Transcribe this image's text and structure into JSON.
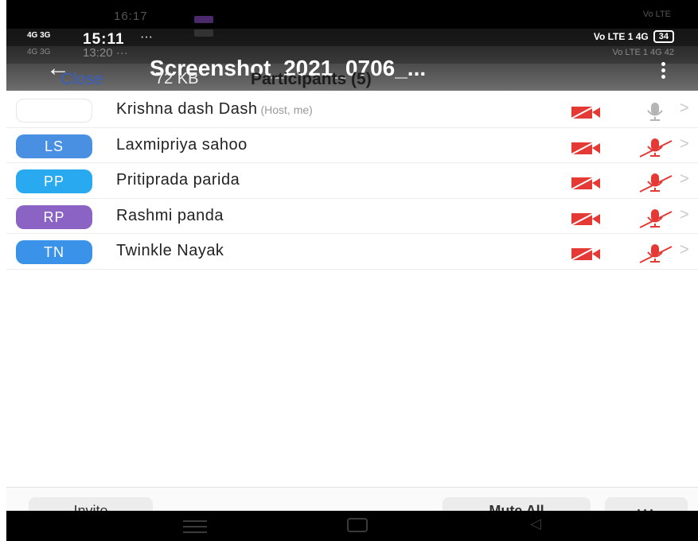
{
  "status_faint": {
    "time": "16:17",
    "right": "Vo LTE"
  },
  "status_main": {
    "signal": "4G 3G",
    "time": "15:11",
    "more": "···",
    "right": "Vo LTE 1 4G",
    "battery": "34"
  },
  "status_ghost": {
    "signal": "4G 3G",
    "time": "13:20 ···",
    "right": "Vo LTE 1 4G 42"
  },
  "header": {
    "back_icon": "arrow-left",
    "file_title": "Screenshot_2021_0706_...",
    "close_label": "Close",
    "file_size": "72 KB",
    "heading": "Participants (5)"
  },
  "participants": [
    {
      "initials": "",
      "name": "Krishna dash Dash",
      "role": "(Host, me)",
      "avatar_color": "",
      "video_off": true,
      "mic_state": "on"
    },
    {
      "initials": "LS",
      "name": "Laxmipriya sahoo",
      "role": "",
      "avatar_color": "#4a90e2",
      "video_off": true,
      "mic_state": "muted"
    },
    {
      "initials": "PP",
      "name": "Pritiprada parida",
      "role": "",
      "avatar_color": "#29a9f0",
      "video_off": true,
      "mic_state": "muted"
    },
    {
      "initials": "RP",
      "name": "Rashmi panda",
      "role": "",
      "avatar_color": "#8a63c4",
      "video_off": true,
      "mic_state": "muted"
    },
    {
      "initials": "TN",
      "name": "Twinkle Nayak",
      "role": "",
      "avatar_color": "#3a93e8",
      "video_off": true,
      "mic_state": "muted"
    }
  ],
  "actions": {
    "invite": "Invite",
    "mute_all": "Mute All",
    "more": "···"
  },
  "colors": {
    "muted_red": "#e53935",
    "mic_gray": "#b5b5b5"
  }
}
